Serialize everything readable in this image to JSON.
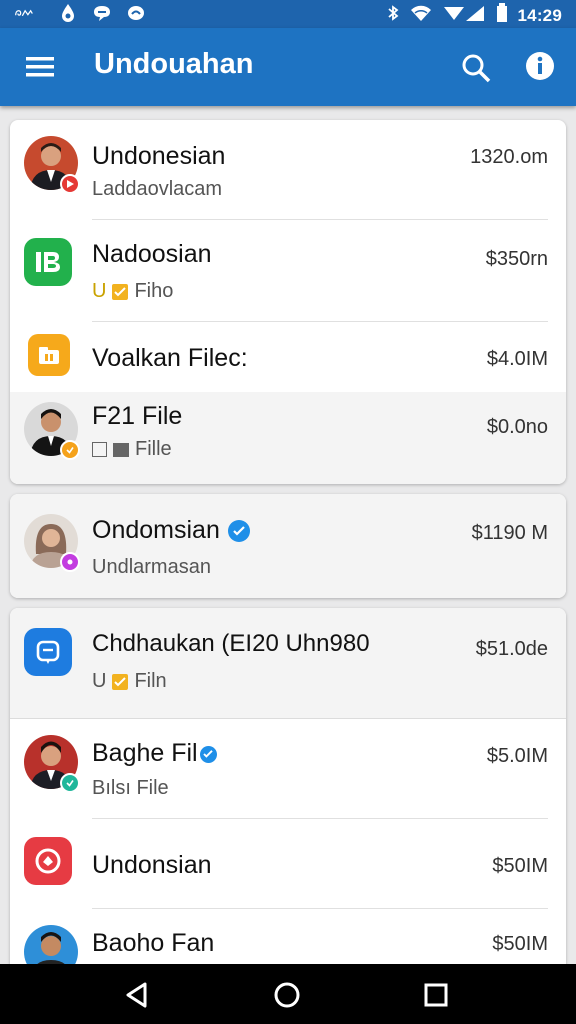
{
  "status_bar": {
    "time": "14:29",
    "left_icons": [
      "signal-app-icon",
      "app-drop-icon",
      "chat-icon",
      "message-icon"
    ],
    "right_icons": [
      "bluetooth-icon",
      "wifi-icon",
      "cell-signal-icon",
      "battery-icon"
    ]
  },
  "app_bar": {
    "title": "Undouahan",
    "accent_color": "#1e73c2"
  },
  "cards": [
    {
      "rows": [
        {
          "title": "Undonesian",
          "subtitle": "Laddaovlacam",
          "amount": "1320.om",
          "icon": "avatar-man-icon",
          "badge": "red-play-badge",
          "shade": false
        },
        {
          "title": "Nadoosian",
          "subtitle_prefix": "U",
          "subtitle": "Fiho",
          "amount": "$350rn",
          "icon": "green-app-icon",
          "shade": false
        },
        {
          "title": "Voalkan Filec:",
          "subtitle": "",
          "amount": "$4.0IM",
          "icon": "orange-folder-icon",
          "shade": false
        },
        {
          "title": "F21 File",
          "subtitle": "Fille",
          "amount": "$0.0no",
          "icon": "avatar-man-suit-icon",
          "badge": "orange-badge",
          "shade": true
        }
      ]
    },
    {
      "rows": [
        {
          "title": "Ondomsian",
          "subtitle": "Undlarmasan",
          "amount": "$1190 M",
          "icon": "avatar-woman-icon",
          "badge": "purple-badge",
          "verified": true,
          "shade": true
        }
      ]
    },
    {
      "rows": [
        {
          "title": "Chdhaukan (EI20 Uhn980",
          "subtitle_prefix": "U",
          "subtitle": "Filn",
          "amount": "$51.0de",
          "icon": "blue-chat-app-icon",
          "shade": true
        },
        {
          "title": "Baghe Fil",
          "subtitle": "Bılsı File",
          "amount": "$5.0IM",
          "icon": "avatar-man-2-icon",
          "badge": "teal-badge",
          "verified": true,
          "shade": false
        },
        {
          "title": "Undonsian",
          "subtitle": "",
          "amount": "$50IM",
          "icon": "red-app-icon",
          "shade": false
        },
        {
          "title": "Baoho Fan",
          "subtitle": "",
          "amount": "$50IM",
          "icon": "avatar-man-3-icon",
          "shade": false
        }
      ]
    }
  ],
  "nav_bar": [
    "back-icon",
    "home-icon",
    "recents-icon"
  ]
}
